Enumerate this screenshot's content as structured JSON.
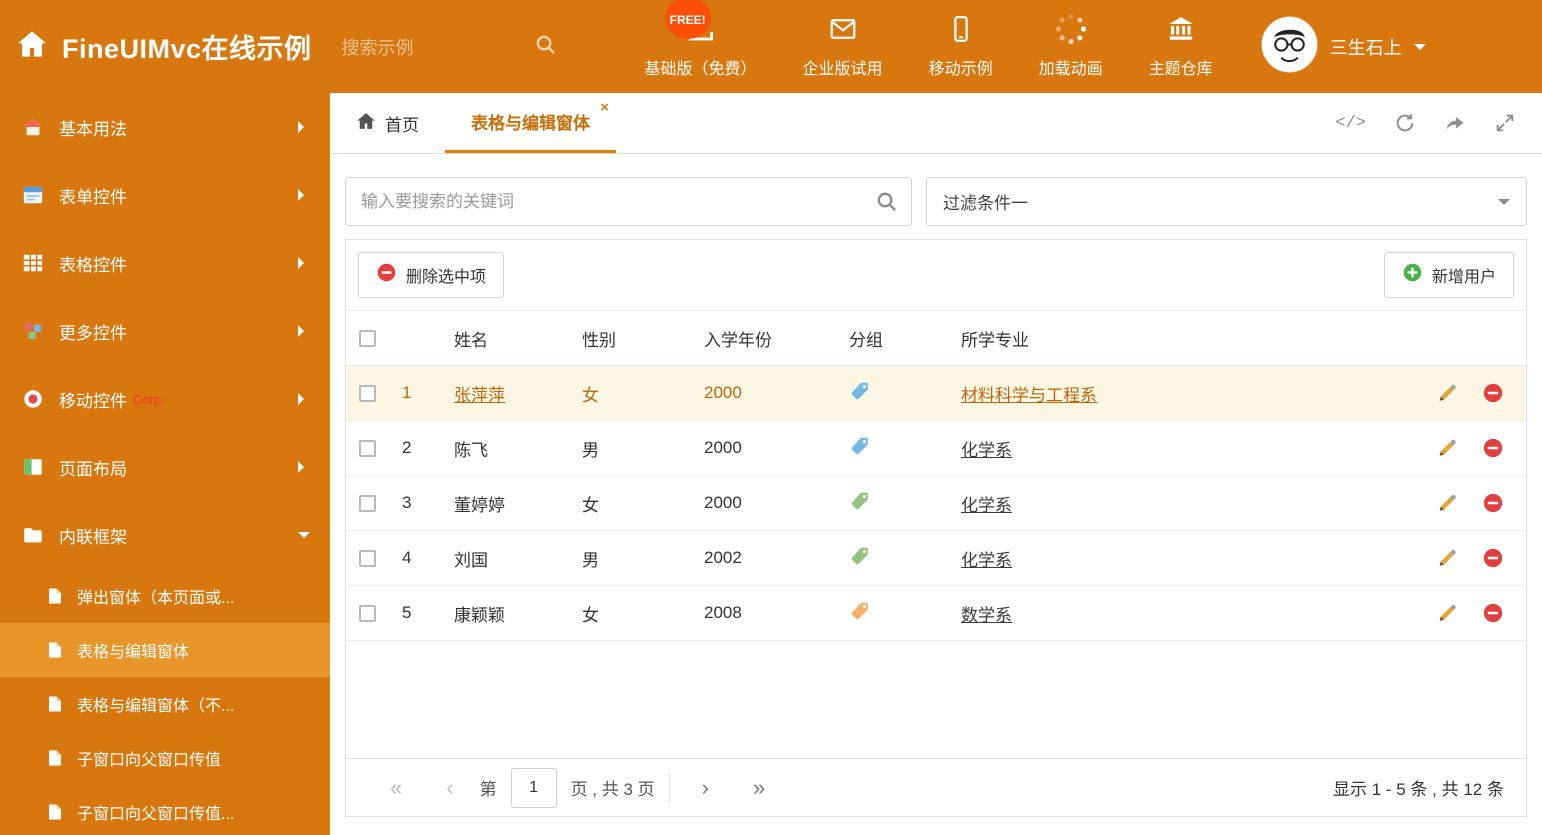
{
  "colors": {
    "primary_orange": "#d9770f",
    "sidebar_active": "#e8962a",
    "free_badge": "#fb4e09",
    "selected_row_bg": "#fcf7e2",
    "selected_row_text": "#c0650f",
    "delete_red": "#e23f3f",
    "add_green": "#44b449",
    "tag_blue": "#74b9e6",
    "tag_green": "#95c281",
    "tag_orange": "#f5b06c"
  },
  "header": {
    "title": "FineUIMvc在线示例",
    "search_placeholder": "搜索示例",
    "free_badge": "FREE!",
    "nav": [
      {
        "label": "基础版（免费）",
        "icon": "download-icon"
      },
      {
        "label": "企业版试用",
        "icon": "envelope-icon"
      },
      {
        "label": "移动示例",
        "icon": "mobile-icon"
      },
      {
        "label": "加载动画",
        "icon": "spinner-icon"
      },
      {
        "label": "主题仓库",
        "icon": "bank-icon"
      }
    ],
    "user": {
      "name": "三生石上"
    }
  },
  "sidebar": {
    "items": [
      {
        "label": "基本用法"
      },
      {
        "label": "表单控件"
      },
      {
        "label": "表格控件"
      },
      {
        "label": "更多控件"
      },
      {
        "label": "移动控件",
        "badge": "Corp."
      },
      {
        "label": "页面布局"
      },
      {
        "label": "内联框架"
      }
    ],
    "subitems": [
      {
        "label": "弹出窗体（本页面或..."
      },
      {
        "label": "表格与编辑窗体"
      },
      {
        "label": "表格与编辑窗体（不..."
      },
      {
        "label": "子窗口向父窗口传值"
      },
      {
        "label": "子窗口向父窗口传值..."
      }
    ]
  },
  "tabs": [
    {
      "label": "首页"
    },
    {
      "label": "表格与编辑窗体"
    }
  ],
  "icons": {
    "code_glyph": "</>",
    "close_glyph": "×"
  },
  "filters": {
    "search_placeholder": "输入要搜索的关键词",
    "filter_value": "过滤条件一"
  },
  "toolbar": {
    "delete_label": "删除选中项",
    "add_label": "新增用户"
  },
  "table": {
    "columns": [
      "姓名",
      "性别",
      "入学年份",
      "分组",
      "所学专业"
    ],
    "rows": [
      {
        "index": "1",
        "name": "张萍萍",
        "gender": "女",
        "year": "2000",
        "tag": "blue",
        "major": "材料科学与工程系"
      },
      {
        "index": "2",
        "name": "陈飞",
        "gender": "男",
        "year": "2000",
        "tag": "blue",
        "major": "化学系"
      },
      {
        "index": "3",
        "name": "董婷婷",
        "gender": "女",
        "year": "2000",
        "tag": "green",
        "major": "化学系"
      },
      {
        "index": "4",
        "name": "刘国",
        "gender": "男",
        "year": "2002",
        "tag": "green",
        "major": "化学系"
      },
      {
        "index": "5",
        "name": "康颖颖",
        "gender": "女",
        "year": "2008",
        "tag": "orange",
        "major": "数学系"
      }
    ]
  },
  "pagination": {
    "first": "«",
    "prev": "‹",
    "page_prefix": "第",
    "current_page": "1",
    "page_suffix": "页 , 共 3 页",
    "next": "›",
    "last": "»",
    "summary": "显示 1 - 5 条 , 共 12 条"
  }
}
